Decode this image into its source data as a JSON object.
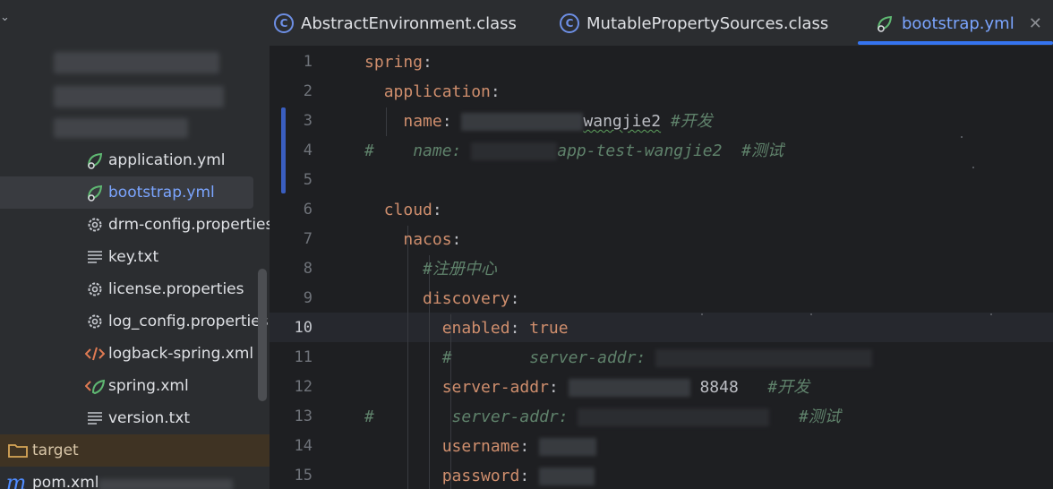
{
  "project_tree": {
    "items": [
      {
        "label": "application.yml",
        "icon": "spring-yaml-icon"
      },
      {
        "label": "bootstrap.yml",
        "icon": "spring-yaml-icon",
        "selected": true
      },
      {
        "label": "drm-config.properties",
        "icon": "gear-icon"
      },
      {
        "label": "key.txt",
        "icon": "text-file-icon"
      },
      {
        "label": "license.properties",
        "icon": "gear-icon"
      },
      {
        "label": "log_config.properties",
        "icon": "gear-icon"
      },
      {
        "label": "logback-spring.xml",
        "icon": "xml-icon"
      },
      {
        "label": "spring.xml",
        "icon": "spring-xml-icon"
      },
      {
        "label": "version.txt",
        "icon": "text-file-icon"
      }
    ],
    "target_folder": "target",
    "pom": "pom.xml",
    "pom_icon_glyph": "m"
  },
  "tabs": [
    {
      "label": "AbstractEnvironment.class",
      "icon": "class-icon",
      "icon_glyph": "C"
    },
    {
      "label": "MutablePropertySources.class",
      "icon": "class-icon",
      "icon_glyph": "C"
    },
    {
      "label": "bootstrap.yml",
      "icon": "spring-yaml-icon",
      "active": true
    }
  ],
  "tab_close_glyph": "✕",
  "editor": {
    "line_numbers": [
      "1",
      "2",
      "3",
      "4",
      "5",
      "6",
      "7",
      "8",
      "9",
      "10",
      "11",
      "12",
      "13",
      "14",
      "15"
    ],
    "current_line": "10",
    "lines": {
      "l1_key": "spring",
      "l1_colon": ":",
      "l2_key": "application",
      "l2_colon": ":",
      "l3_key": "name",
      "l3_colon": ":",
      "l3_value": "wangjie2",
      "l3_comment": "#开发",
      "l4_hash": "#",
      "l4_text": "name:",
      "l4_value": "app-test-wangjie2",
      "l4_comment": "#测试",
      "l6_key": "cloud",
      "l6_colon": ":",
      "l7_key": "nacos",
      "l7_colon": ":",
      "l8_comment": "#注册中心",
      "l9_key": "discovery",
      "l9_colon": ":",
      "l10_key": "enabled",
      "l10_colon": ":",
      "l10_value": "true",
      "l11_hash": "#",
      "l11_text": "server-addr:",
      "l12_key": "server-addr",
      "l12_colon": ":",
      "l12_value": "8848",
      "l12_comment": "#开发",
      "l13_hash": "#",
      "l13_text": "server-addr:",
      "l13_comment": "#测试",
      "l14_key": "username",
      "l14_colon": ":",
      "l15_key": "password",
      "l15_colon": ":"
    }
  },
  "colors": {
    "background": "#1e1f22",
    "panel": "#2b2d30",
    "accent": "#3574f0",
    "keyword": "#cf8e6d",
    "comment": "#7a7e85",
    "selected_text": "#7ba5ff"
  }
}
